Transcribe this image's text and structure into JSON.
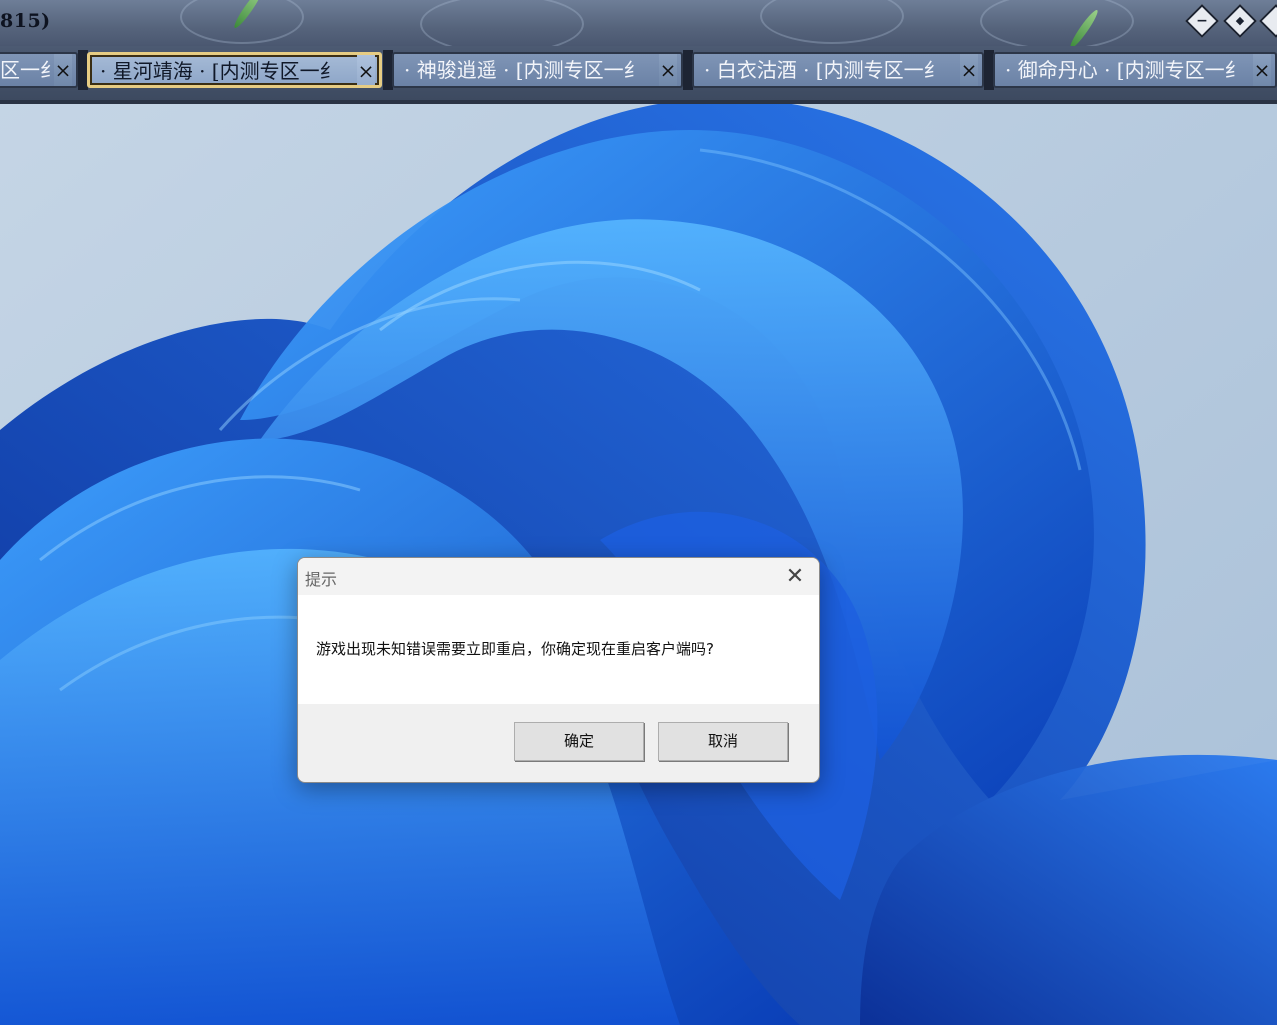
{
  "game_client": {
    "title": "815)",
    "tabs": [
      {
        "label": "区一纟",
        "close": "×",
        "active": false
      },
      {
        "label": "· 星河靖海 · [内测专区一纟",
        "close": "×",
        "active": true
      },
      {
        "label": "· 神骏逍遥 · [内测专区一纟",
        "close": "×",
        "active": false
      },
      {
        "label": "· 白衣沽酒 · [内测专区一纟",
        "close": "×",
        "active": false
      },
      {
        "label": "· 御命丹心 · [内测专区一纟",
        "close": "×",
        "active": false
      }
    ],
    "window_controls": {
      "minimize_glyph": "−",
      "restore_glyph": "◆"
    }
  },
  "dialog": {
    "title": "提示",
    "close_glyph": "✕",
    "message": "游戏出现未知错误需要立即重启，你确定现在重启客户端吗?",
    "ok_label": "确定",
    "cancel_label": "取消"
  },
  "colors": {
    "wallpaper_bg": "#b9cde0",
    "bloom_blue": "#1f6fe8",
    "dialog_bg": "#f0f0f0"
  }
}
